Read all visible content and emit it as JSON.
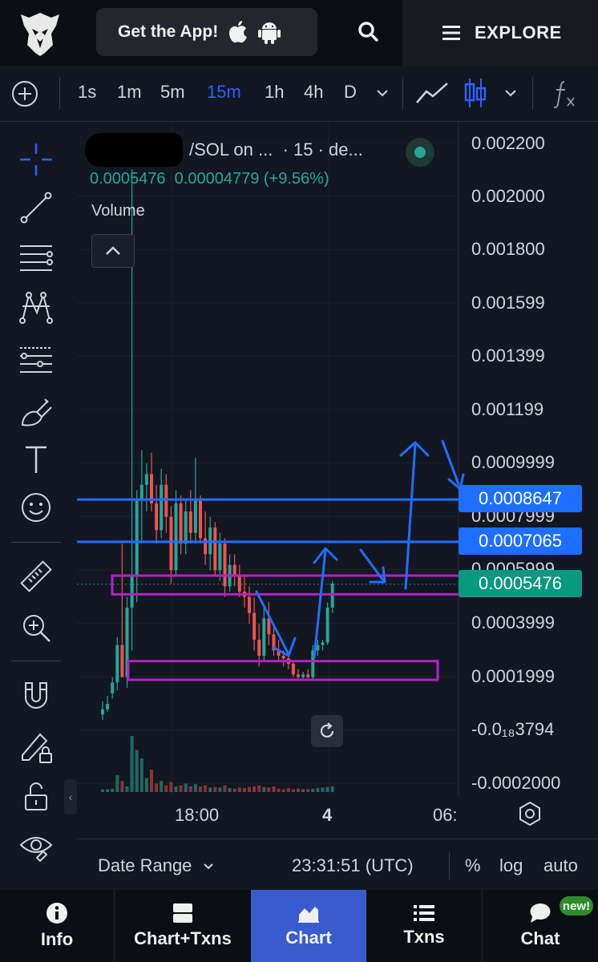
{
  "header": {
    "get_app_label": "Get the App!",
    "explore_label": "EXPLORE"
  },
  "timeframes": {
    "items": [
      "1s",
      "1m",
      "5m",
      "15m",
      "1h",
      "4h",
      "D"
    ],
    "active": "15m"
  },
  "chart_header": {
    "pair_label": "/SOL on ...",
    "interval_label": "· 15 · de...",
    "price": "0.0005476",
    "change": "0.00004779 (+9.56%)",
    "volume_label": "Volume"
  },
  "price_axis": {
    "labels": [
      "0.002200",
      "0.002000",
      "0.001800",
      "0.001599",
      "0.001399",
      "0.001199",
      "0.0009999",
      "0.0007999",
      "0.0005999",
      "0.0003999",
      "0.0001999",
      "-0.0₁₈3794",
      "-0.0002000"
    ],
    "tags": [
      {
        "value": "0.0008647",
        "color": "#1e6fff"
      },
      {
        "value": "0.0007065",
        "color": "#1e6fff"
      },
      {
        "value": "0.0005476",
        "color": "#089981"
      }
    ]
  },
  "time_axis": {
    "labels": [
      "18:00",
      "4",
      "06:"
    ]
  },
  "status_bar": {
    "date_range_label": "Date Range",
    "clock": "23:31:51 (UTC)",
    "percent_label": "%",
    "log_label": "log",
    "auto_label": "auto"
  },
  "bottom_nav": {
    "items": [
      {
        "label": "Info",
        "icon": "info-icon"
      },
      {
        "label": "Chart+Txns",
        "icon": "split-panel-icon"
      },
      {
        "label": "Chart",
        "icon": "chart-area-icon",
        "active": true
      },
      {
        "label": "Txns",
        "icon": "list-icon"
      },
      {
        "label": "Chat",
        "icon": "chat-bubble-icon"
      }
    ],
    "new_badge": "new!"
  },
  "colors": {
    "background": "#131722",
    "up": "#26a69a",
    "down": "#ef5350",
    "accent": "#2962ff",
    "zone": "#b620c8",
    "annotation": "#1e6fff"
  },
  "chart_data": {
    "type": "candlestick",
    "y_scale_min": -0.0002,
    "y_scale_max": 0.0022,
    "last_price": 0.0005476,
    "candles": [
      {
        "o": 6e-05,
        "h": 0.00011,
        "l": 4e-05,
        "c": 8e-05
      },
      {
        "o": 8e-05,
        "h": 0.00013,
        "l": 7e-05,
        "c": 0.0001
      },
      {
        "o": 0.00014,
        "h": 0.0002,
        "l": 0.00012,
        "c": 0.00018
      },
      {
        "o": 0.00018,
        "h": 0.00035,
        "l": 0.00015,
        "c": 0.00032
      },
      {
        "o": 0.00032,
        "h": 0.0007,
        "l": 0.00028,
        "c": 0.0002
      },
      {
        "o": 0.0002,
        "h": 0.0005,
        "l": 0.00016,
        "c": 0.00046
      },
      {
        "o": 0.00046,
        "h": 0.0021,
        "l": 0.0003,
        "c": 0.00058
      },
      {
        "o": 0.00058,
        "h": 0.0009,
        "l": 0.00048,
        "c": 0.00086
      },
      {
        "o": 0.00086,
        "h": 0.00105,
        "l": 0.0007,
        "c": 0.00092
      },
      {
        "o": 0.00092,
        "h": 0.001,
        "l": 0.00082,
        "c": 0.00096
      },
      {
        "o": 0.00096,
        "h": 0.00104,
        "l": 0.00082,
        "c": 0.00085
      },
      {
        "o": 0.00085,
        "h": 0.00092,
        "l": 0.0007,
        "c": 0.00075
      },
      {
        "o": 0.00075,
        "h": 0.00098,
        "l": 0.00072,
        "c": 0.00092
      },
      {
        "o": 0.00092,
        "h": 0.00096,
        "l": 0.00074,
        "c": 0.0008
      },
      {
        "o": 0.0008,
        "h": 0.00084,
        "l": 0.00055,
        "c": 0.0006
      },
      {
        "o": 0.0006,
        "h": 0.0009,
        "l": 0.00058,
        "c": 0.00085
      },
      {
        "o": 0.00085,
        "h": 0.00088,
        "l": 0.00066,
        "c": 0.0007
      },
      {
        "o": 0.0007,
        "h": 0.00086,
        "l": 0.00066,
        "c": 0.00082
      },
      {
        "o": 0.00082,
        "h": 0.0009,
        "l": 0.0007,
        "c": 0.00074
      },
      {
        "o": 0.00074,
        "h": 0.00102,
        "l": 0.0007,
        "c": 0.00086
      },
      {
        "o": 0.00086,
        "h": 0.00088,
        "l": 0.0007,
        "c": 0.00072
      },
      {
        "o": 0.00072,
        "h": 0.00082,
        "l": 0.00062,
        "c": 0.00066
      },
      {
        "o": 0.00066,
        "h": 0.0008,
        "l": 0.0006,
        "c": 0.00076
      },
      {
        "o": 0.00076,
        "h": 0.00078,
        "l": 0.00058,
        "c": 0.0006
      },
      {
        "o": 0.0006,
        "h": 0.00074,
        "l": 0.00056,
        "c": 0.0007
      },
      {
        "o": 0.0007,
        "h": 0.00072,
        "l": 0.0005,
        "c": 0.00054
      },
      {
        "o": 0.00054,
        "h": 0.00066,
        "l": 0.00052,
        "c": 0.00062
      },
      {
        "o": 0.00062,
        "h": 0.00066,
        "l": 0.00054,
        "c": 0.00058
      },
      {
        "o": 0.00058,
        "h": 0.00062,
        "l": 0.0005,
        "c": 0.00052
      },
      {
        "o": 0.00052,
        "h": 0.00058,
        "l": 0.00046,
        "c": 0.0005
      },
      {
        "o": 0.0005,
        "h": 0.00054,
        "l": 0.0004,
        "c": 0.00044
      },
      {
        "o": 0.00044,
        "h": 0.0005,
        "l": 0.0003,
        "c": 0.00034
      },
      {
        "o": 0.00034,
        "h": 0.0004,
        "l": 0.00024,
        "c": 0.00028
      },
      {
        "o": 0.00028,
        "h": 0.00046,
        "l": 0.00026,
        "c": 0.00042
      },
      {
        "o": 0.00042,
        "h": 0.00048,
        "l": 0.00032,
        "c": 0.00036
      },
      {
        "o": 0.00036,
        "h": 0.0004,
        "l": 0.00028,
        "c": 0.0003
      },
      {
        "o": 0.0003,
        "h": 0.00034,
        "l": 0.00026,
        "c": 0.00028
      },
      {
        "o": 0.00028,
        "h": 0.0003,
        "l": 0.00024,
        "c": 0.00027
      },
      {
        "o": 0.00027,
        "h": 0.00029,
        "l": 0.00023,
        "c": 0.00025
      },
      {
        "o": 0.00025,
        "h": 0.00026,
        "l": 0.0002,
        "c": 0.00021
      },
      {
        "o": 0.00021,
        "h": 0.00023,
        "l": 0.00019,
        "c": 0.0002
      },
      {
        "o": 0.0002,
        "h": 0.00022,
        "l": 0.00019,
        "c": 0.00021
      },
      {
        "o": 0.00021,
        "h": 0.00023,
        "l": 0.00019,
        "c": 0.0002
      },
      {
        "o": 0.0002,
        "h": 0.00032,
        "l": 0.00019,
        "c": 0.0003
      },
      {
        "o": 0.0003,
        "h": 0.00034,
        "l": 0.00028,
        "c": 0.00032
      },
      {
        "o": 0.00032,
        "h": 0.00034,
        "l": 0.0003,
        "c": 0.00033
      },
      {
        "o": 0.00033,
        "h": 0.00048,
        "l": 0.00032,
        "c": 0.00046
      },
      {
        "o": 0.00046,
        "h": 0.00056,
        "l": 0.00044,
        "c": 0.00055
      }
    ],
    "volumes": [
      0.05,
      0.05,
      0.06,
      0.3,
      0.2,
      0.1,
      1.0,
      0.75,
      0.6,
      0.25,
      0.4,
      0.15,
      0.2,
      0.12,
      0.18,
      0.1,
      0.12,
      0.15,
      0.1,
      0.14,
      0.1,
      0.12,
      0.08,
      0.09,
      0.08,
      0.12,
      0.07,
      0.06,
      0.08,
      0.07,
      0.09,
      0.1,
      0.12,
      0.09,
      0.08,
      0.1,
      0.06,
      0.05,
      0.07,
      0.05,
      0.06,
      0.05,
      0.05,
      0.06,
      0.07,
      0.08,
      0.09,
      0.1
    ],
    "horizontal_lines": [
      0.0008647,
      0.0007065
    ],
    "zones": [
      {
        "from": 0.00051,
        "to": 0.00058
      },
      {
        "from": 0.00019,
        "to": 0.00026
      }
    ]
  }
}
